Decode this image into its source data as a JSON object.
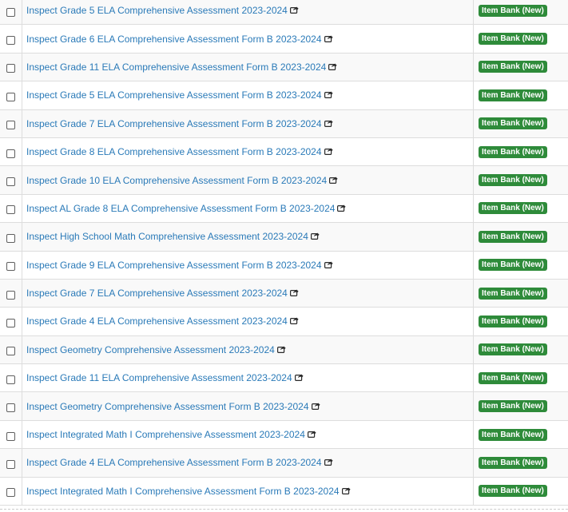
{
  "rows": [
    {
      "title": "Inspect Grade 5 ELA Comprehensive Assessment 2023-2024",
      "badge": "Item Bank (New)"
    },
    {
      "title": "Inspect Grade 6 ELA Comprehensive Assessment Form B 2023-2024",
      "badge": "Item Bank (New)"
    },
    {
      "title": "Inspect Grade 11 ELA Comprehensive Assessment Form B 2023-2024",
      "badge": "Item Bank (New)"
    },
    {
      "title": "Inspect Grade 5 ELA Comprehensive Assessment Form B 2023-2024",
      "badge": "Item Bank (New)"
    },
    {
      "title": "Inspect Grade 7 ELA Comprehensive Assessment Form B 2023-2024",
      "badge": "Item Bank (New)"
    },
    {
      "title": "Inspect Grade 8 ELA Comprehensive Assessment Form B 2023-2024",
      "badge": "Item Bank (New)"
    },
    {
      "title": "Inspect Grade 10 ELA Comprehensive Assessment Form B 2023-2024",
      "badge": "Item Bank (New)"
    },
    {
      "title": "Inspect AL Grade 8 ELA Comprehensive Assessment Form B 2023-2024",
      "badge": "Item Bank (New)"
    },
    {
      "title": "Inspect High School Math Comprehensive Assessment 2023-2024",
      "badge": "Item Bank (New)"
    },
    {
      "title": "Inspect Grade 9 ELA Comprehensive Assessment Form B 2023-2024",
      "badge": "Item Bank (New)"
    },
    {
      "title": "Inspect Grade 7 ELA Comprehensive Assessment 2023-2024",
      "badge": "Item Bank (New)"
    },
    {
      "title": "Inspect Grade 4 ELA Comprehensive Assessment 2023-2024",
      "badge": "Item Bank (New)"
    },
    {
      "title": "Inspect Geometry Comprehensive Assessment 2023-2024",
      "badge": "Item Bank (New)"
    },
    {
      "title": "Inspect Grade 11 ELA Comprehensive Assessment 2023-2024",
      "badge": "Item Bank (New)"
    },
    {
      "title": "Inspect Geometry Comprehensive Assessment Form B 2023-2024",
      "badge": "Item Bank (New)"
    },
    {
      "title": "Inspect Integrated Math I Comprehensive Assessment 2023-2024",
      "badge": "Item Bank (New)"
    },
    {
      "title": "Inspect Grade 4 ELA Comprehensive Assessment Form B 2023-2024",
      "badge": "Item Bank (New)"
    },
    {
      "title": "Inspect Integrated Math I Comprehensive Assessment Form B 2023-2024",
      "badge": "Item Bank (New)"
    }
  ],
  "icons": {
    "title_link": "external-link-icon"
  },
  "colors": {
    "link": "#2a7ab8",
    "badge_bg": "#2e8b3a",
    "badge_text": "#ffffff",
    "row_stripe": "#f9f9f9",
    "border": "#dddddd"
  }
}
